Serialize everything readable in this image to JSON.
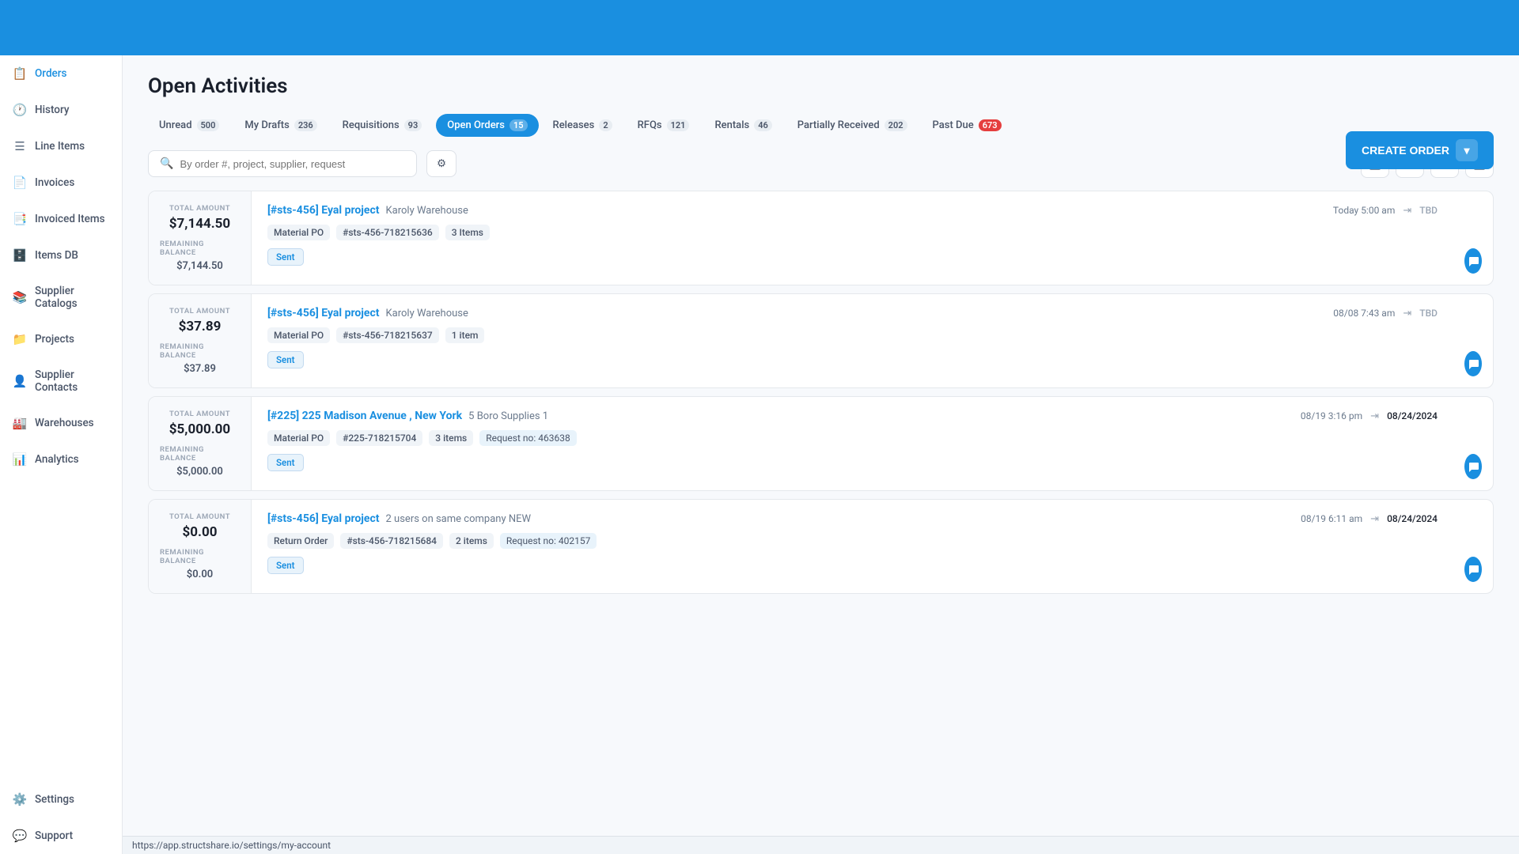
{
  "topbar": {},
  "sidebar": {
    "items": [
      {
        "id": "orders",
        "label": "Orders",
        "icon": "📋",
        "active": true
      },
      {
        "id": "history",
        "label": "History",
        "icon": "🕐",
        "active": false
      },
      {
        "id": "line-items",
        "label": "Line Items",
        "icon": "☰",
        "active": false
      },
      {
        "id": "invoices",
        "label": "Invoices",
        "icon": "📄",
        "active": false
      },
      {
        "id": "invoiced-items",
        "label": "Invoiced Items",
        "icon": "📑",
        "active": false
      },
      {
        "id": "items-db",
        "label": "Items DB",
        "icon": "🗄️",
        "active": false
      },
      {
        "id": "supplier-catalogs",
        "label": "Supplier Catalogs",
        "icon": "📚",
        "active": false
      },
      {
        "id": "projects",
        "label": "Projects",
        "icon": "📁",
        "active": false
      },
      {
        "id": "supplier-contacts",
        "label": "Supplier Contacts",
        "icon": "👤",
        "active": false
      },
      {
        "id": "warehouses",
        "label": "Warehouses",
        "icon": "🏭",
        "active": false
      },
      {
        "id": "analytics",
        "label": "Analytics",
        "icon": "📊",
        "active": false
      }
    ],
    "bottom_items": [
      {
        "id": "settings",
        "label": "Settings",
        "icon": "⚙️"
      },
      {
        "id": "support",
        "label": "Support",
        "icon": "💬"
      }
    ]
  },
  "page": {
    "title": "Open Activities",
    "create_button_label": "CREATE ORDER"
  },
  "tabs": [
    {
      "id": "unread",
      "label": "Unread",
      "badge": "500",
      "active": false,
      "badge_red": false
    },
    {
      "id": "my-drafts",
      "label": "My Drafts",
      "badge": "236",
      "active": false,
      "badge_red": false
    },
    {
      "id": "requisitions",
      "label": "Requisitions",
      "badge": "93",
      "active": false,
      "badge_red": false
    },
    {
      "id": "open-orders",
      "label": "Open Orders",
      "badge": "15",
      "active": true,
      "badge_red": false
    },
    {
      "id": "releases",
      "label": "Releases",
      "badge": "2",
      "active": false,
      "badge_red": false
    },
    {
      "id": "rfqs",
      "label": "RFQs",
      "badge": "121",
      "active": false,
      "badge_red": false
    },
    {
      "id": "rentals",
      "label": "Rentals",
      "badge": "46",
      "active": false,
      "badge_red": false
    },
    {
      "id": "partially-received",
      "label": "Partially Received",
      "badge": "202",
      "active": false,
      "badge_red": false
    },
    {
      "id": "past-due",
      "label": "Past Due",
      "badge": "673",
      "active": false,
      "badge_red": true
    }
  ],
  "search": {
    "placeholder": "By order #, project, supplier, request"
  },
  "orders": [
    {
      "id": "order-1",
      "total_amount_label": "TOTAL AMOUNT",
      "total_amount": "$7,144.50",
      "remaining_balance_label": "REMAINING BALANCE",
      "remaining_balance": "$7,144.50",
      "project": "[#sts-456] Eyal project",
      "supplier": "Karoly Warehouse",
      "date": "Today 5:00 am",
      "delivery_date": "TBD",
      "delivery_tbd": true,
      "po_type": "Material PO",
      "po_number": "#sts-456-718215636",
      "items_count": "3 Items",
      "status": "Sent",
      "request_no": null
    },
    {
      "id": "order-2",
      "total_amount_label": "TOTAL AMOUNT",
      "total_amount": "$37.89",
      "remaining_balance_label": "REMAINING BALANCE",
      "remaining_balance": "$37.89",
      "project": "[#sts-456] Eyal project",
      "supplier": "Karoly Warehouse",
      "date": "08/08 7:43 am",
      "delivery_date": "TBD",
      "delivery_tbd": true,
      "po_type": "Material PO",
      "po_number": "#sts-456-718215637",
      "items_count": "1 item",
      "status": "Sent",
      "request_no": null
    },
    {
      "id": "order-3",
      "total_amount_label": "TOTAL AMOUNT",
      "total_amount": "$5,000.00",
      "remaining_balance_label": "REMAINING BALANCE",
      "remaining_balance": "$5,000.00",
      "project": "[#225] 225 Madison Avenue , New York",
      "supplier": "5 Boro Supplies 1",
      "date": "08/19 3:16 pm",
      "delivery_date": "08/24/2024",
      "delivery_tbd": false,
      "po_type": "Material PO",
      "po_number": "#225-718215704",
      "items_count": "3 items",
      "status": "Sent",
      "request_no": "Request no: 463638"
    },
    {
      "id": "order-4",
      "total_amount_label": "TOTAL AMOUNT",
      "total_amount": "$0.00",
      "remaining_balance_label": "REMAINING BALANCE",
      "remaining_balance": "$0.00",
      "project": "[#sts-456] Eyal project",
      "supplier": "2 users on same company NEW",
      "date": "08/19 6:11 am",
      "delivery_date": "08/24/2024",
      "delivery_tbd": false,
      "po_type": "Return Order",
      "po_number": "#sts-456-718215684",
      "items_count": "2 items",
      "status": "Sent",
      "request_no": "Request no: 402157"
    }
  ],
  "url_bar": "https://app.structshare.io/settings/my-account"
}
